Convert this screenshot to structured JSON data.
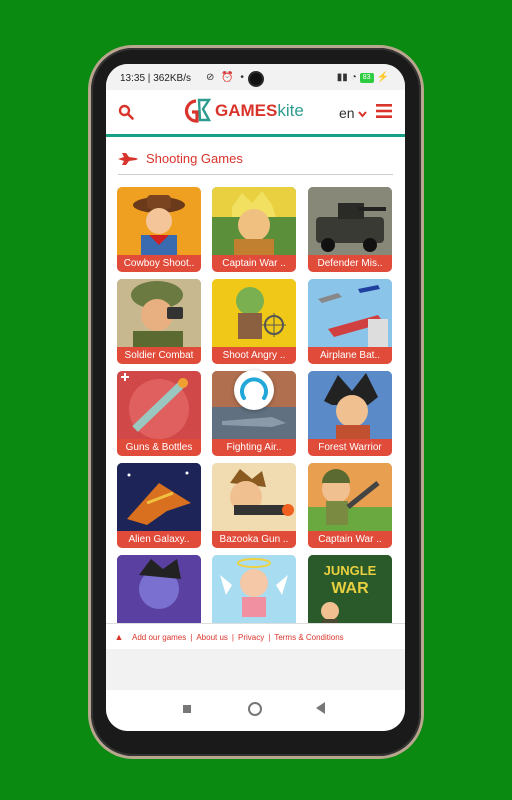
{
  "status": {
    "time": "13:35",
    "speed": "362KB/s",
    "battery": "83"
  },
  "header": {
    "logo_main": "GAMES",
    "logo_sub": "kite",
    "language": "en"
  },
  "category": {
    "title": "Shooting Games"
  },
  "games": [
    {
      "label": "Cowboy Shoot..",
      "bg": "#f0a020"
    },
    {
      "label": "Captain War ..",
      "bg": "#5b8f3a"
    },
    {
      "label": "Defender Mis..",
      "bg": "#6b6b60"
    },
    {
      "label": "Soldier Combat",
      "bg": "#7a8a4a"
    },
    {
      "label": "Shoot Angry ..",
      "bg": "#e8c020"
    },
    {
      "label": "Airplane Bat..",
      "bg": "#7ab8e0"
    },
    {
      "label": "Guns & Bottles",
      "bg": "#d04848"
    },
    {
      "label": "Fighting Air..",
      "bg": "#a06040"
    },
    {
      "label": "Forest Warrior",
      "bg": "#4a7ac0"
    },
    {
      "label": "Alien Galaxy..",
      "bg": "#1a2a60"
    },
    {
      "label": "Bazooka Gun ..",
      "bg": "#e8d0a0"
    },
    {
      "label": "Captain War ..",
      "bg": "#e07830"
    },
    {
      "label": "",
      "bg": "#5a40a0"
    },
    {
      "label": "",
      "bg": "#9ad8f0"
    },
    {
      "label": "",
      "bg": "#2a6a2a",
      "text": "JUNGLE WAR"
    }
  ],
  "footer": {
    "links": [
      "Add our games",
      "About us",
      "Privacy",
      "Terms & Conditions"
    ]
  },
  "colors": {
    "accent_red": "#d9342b",
    "tile_label": "#e14b3a",
    "header_line": "#16a085"
  }
}
